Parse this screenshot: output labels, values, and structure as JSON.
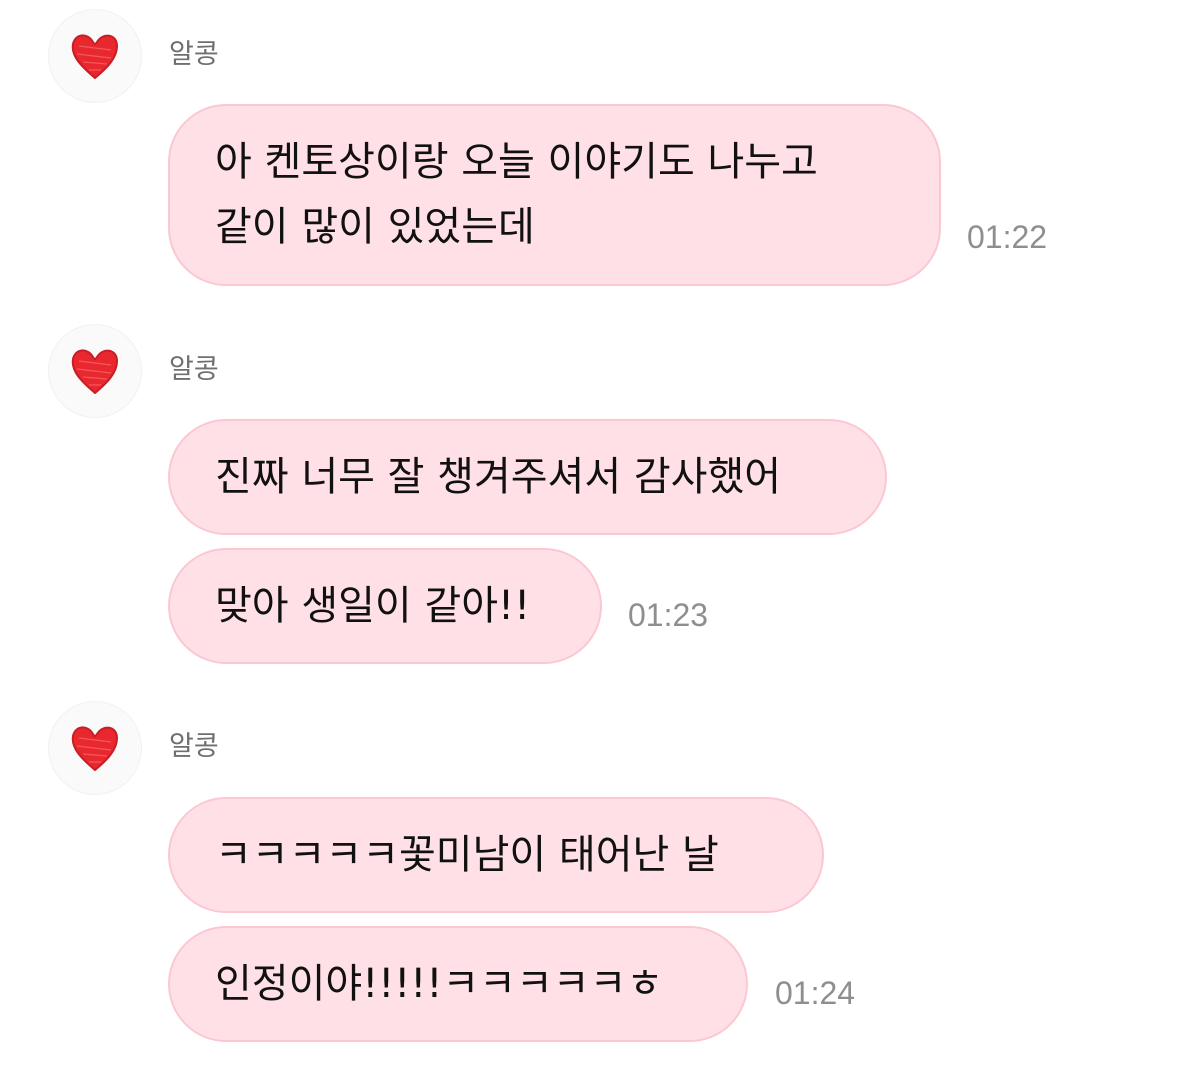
{
  "theme": {
    "bubble_color": "#ffe0e6",
    "bubble_border": "#fbc8d2",
    "heart_color": "#e8282e"
  },
  "groups": [
    {
      "sender": "알콩",
      "avatar_icon": "red-heart-icon",
      "messages": [
        {
          "line1": "아 켄토상이랑 오늘 이야기도 나누고",
          "line2": "같이 많이 있었는데"
        }
      ],
      "time": "01:22"
    },
    {
      "sender": "알콩",
      "avatar_icon": "red-heart-icon",
      "messages": [
        {
          "text": "진짜 너무 잘 챙겨주셔서 감사했어"
        },
        {
          "text": "맞아 생일이 같아!!"
        }
      ],
      "time": "01:23"
    },
    {
      "sender": "알콩",
      "avatar_icon": "red-heart-icon",
      "messages": [
        {
          "text": "ㅋㅋㅋㅋㅋ꽃미남이 태어난 날"
        },
        {
          "text": "인정이야!!!!!ㅋㅋㅋㅋㅋㅎ"
        }
      ],
      "time": "01:24"
    }
  ]
}
